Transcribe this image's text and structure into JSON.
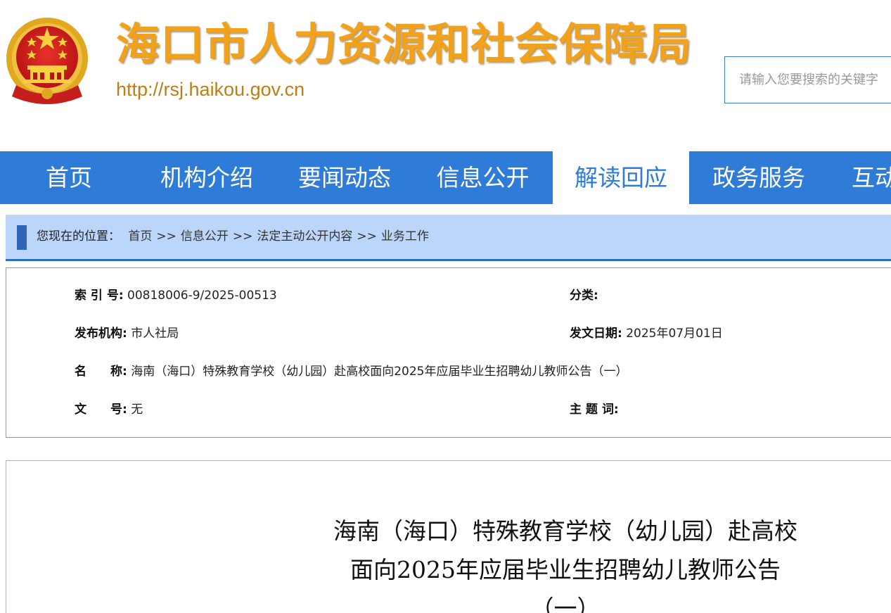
{
  "header": {
    "title": "海口市人力资源和社会保障局",
    "url": "http://rsj.haikou.gov.cn",
    "search_placeholder": "请输入您要搜索的关键字",
    "colors": {
      "title": "#f2a21a",
      "url": "#c07d12",
      "search_border": "#3d7ad6"
    }
  },
  "nav": {
    "items": [
      {
        "label": "首页"
      },
      {
        "label": "机构介绍"
      },
      {
        "label": "要闻动态"
      },
      {
        "label": "信息公开"
      },
      {
        "label": "解读回应",
        "active": true
      },
      {
        "label": "政务服务"
      },
      {
        "label": "互动"
      }
    ],
    "colors": {
      "background": "#2f7bd8",
      "active_bg": "#ffffff",
      "active_text": "#2f7bd8"
    }
  },
  "breadcrumb": {
    "prefix": "您现在的位置：",
    "items": [
      "首页",
      "信息公开",
      "法定主动公开内容",
      "业务工作"
    ],
    "separator": ">>",
    "colors": {
      "background": "#bcd5fa",
      "marker": "#2e66b8"
    }
  },
  "meta": {
    "index_label": "索 引 号:",
    "index_value": "00818006-9/2025-00513",
    "category_label": "分类:",
    "category_value": "",
    "publisher_label": "发布机构:",
    "publisher_value": "市人社局",
    "date_label": "发文日期:",
    "date_value": "2025年07月01日",
    "name_label": "名　　称:",
    "name_value": "海南（海口）特殊教育学校（幼儿园）赴高校面向2025年应届毕业生招聘幼儿教师公告（一）",
    "docno_label": "文　　号:",
    "docno_value": "无",
    "keywords_label": "主 题 词:",
    "keywords_value": ""
  },
  "article": {
    "title_lines": [
      "海南（海口）特殊教育学校（幼儿园）赴高校",
      "面向2025年应届毕业生招聘幼儿教师公告",
      "（一）"
    ]
  },
  "icons": {
    "emblem": "national-emblem-icon"
  }
}
